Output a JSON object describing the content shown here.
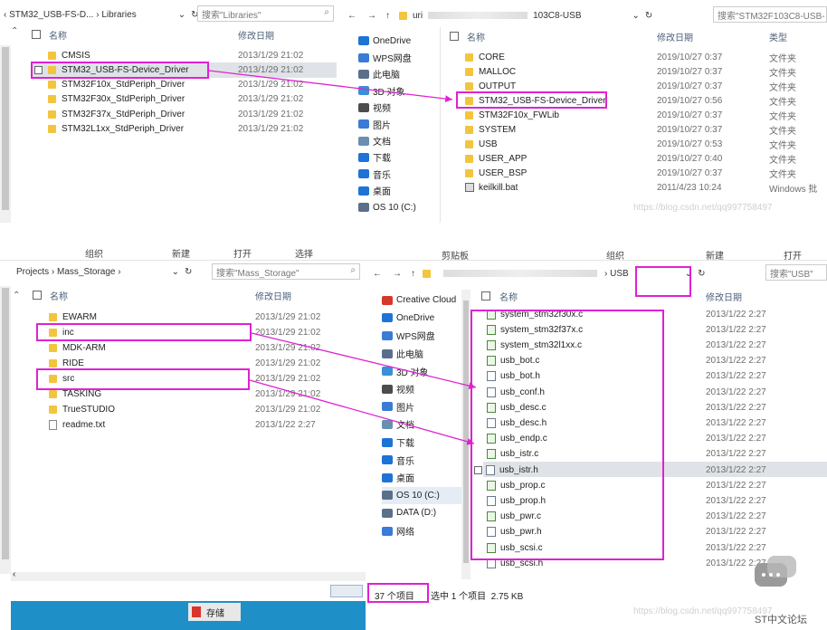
{
  "topLeft": {
    "address": "STM32_USB-FS-D...",
    "address2": "Libraries",
    "search": "搜索\"Libraries\"",
    "col_name": "名称",
    "col_date": "修改日期",
    "rows": [
      {
        "name": "CMSIS",
        "date": "2013/1/29 21:02"
      },
      {
        "name": "STM32_USB-FS-Device_Driver",
        "date": "2013/1/29 21:02"
      },
      {
        "name": "STM32F10x_StdPeriph_Driver",
        "date": "2013/1/29 21:02"
      },
      {
        "name": "STM32F30x_StdPeriph_Driver",
        "date": "2013/1/29 21:02"
      },
      {
        "name": "STM32F37x_StdPeriph_Driver",
        "date": "2013/1/29 21:02"
      },
      {
        "name": "STM32L1xx_StdPeriph_Driver",
        "date": "2013/1/29 21:02"
      }
    ]
  },
  "topRight": {
    "address": "uri",
    "address_tail": "103C8-USB",
    "search": "搜索\"STM32F103C8-USB-",
    "col_name": "名称",
    "col_date": "修改日期",
    "col_type": "类型",
    "nav": [
      "OneDrive",
      "WPS网盘",
      "此电脑",
      "3D 对象",
      "视频",
      "图片",
      "文档",
      "下载",
      "音乐",
      "桌面",
      "OS 10 (C:)"
    ],
    "rows": [
      {
        "name": "CORE",
        "date": "2019/10/27 0:37",
        "type": "文件夹"
      },
      {
        "name": "MALLOC",
        "date": "2019/10/27 0:37",
        "type": "文件夹"
      },
      {
        "name": "OUTPUT",
        "date": "2019/10/27 0:37",
        "type": "文件夹"
      },
      {
        "name": "STM32_USB-FS-Device_Driver",
        "date": "2019/10/27 0:56",
        "type": "文件夹"
      },
      {
        "name": "STM32F10x_FWLib",
        "date": "2019/10/27 0:37",
        "type": "文件夹"
      },
      {
        "name": "SYSTEM",
        "date": "2019/10/27 0:37",
        "type": "文件夹"
      },
      {
        "name": "USB",
        "date": "2019/10/27 0:53",
        "type": "文件夹"
      },
      {
        "name": "USER_APP",
        "date": "2019/10/27 0:40",
        "type": "文件夹"
      },
      {
        "name": "USER_BSP",
        "date": "2019/10/27 0:37",
        "type": "文件夹"
      },
      {
        "name": "keilkill.bat",
        "date": "2011/4/23 10:24",
        "type": "Windows 批"
      }
    ],
    "watermark": "https://blog.csdn.net/qq997758497"
  },
  "bottomLeft": {
    "ribbon": [
      "组织",
      "新建",
      "打开",
      "选择"
    ],
    "address": "Projects",
    "address2": "Mass_Storage",
    "search": "搜索\"Mass_Storage\"",
    "col_name": "名称",
    "col_date": "修改日期",
    "rows": [
      {
        "name": "EWARM",
        "date": "2013/1/29 21:02",
        "kind": "folder"
      },
      {
        "name": "inc",
        "date": "2013/1/29 21:02",
        "kind": "folder"
      },
      {
        "name": "MDK-ARM",
        "date": "2013/1/29 21:02",
        "kind": "folder"
      },
      {
        "name": "RIDE",
        "date": "2013/1/29 21:02",
        "kind": "folder"
      },
      {
        "name": "src",
        "date": "2013/1/29 21:02",
        "kind": "folder"
      },
      {
        "name": "TASKING",
        "date": "2013/1/29 21:02",
        "kind": "folder"
      },
      {
        "name": "TrueSTUDIO",
        "date": "2013/1/29 21:02",
        "kind": "folder"
      },
      {
        "name": "readme.txt",
        "date": "2013/1/22 2:27",
        "kind": "txt"
      }
    ],
    "taskbar": "存储"
  },
  "bottomRight": {
    "ribbon": [
      "剪贴板",
      "组织",
      "新建",
      "打开"
    ],
    "address": "USB",
    "search": "搜索\"USB\"",
    "col_name": "名称",
    "col_date": "修改日期",
    "nav": [
      "Creative Cloud",
      "OneDrive",
      "WPS网盘",
      "此电脑",
      "3D 对象",
      "视频",
      "图片",
      "文档",
      "下载",
      "音乐",
      "桌面",
      "OS 10 (C:)",
      "DATA (D:)",
      "网络"
    ],
    "rows": [
      {
        "name": "system_stm32f30x.c",
        "date": "2013/1/22 2:27",
        "green": true
      },
      {
        "name": "system_stm32f37x.c",
        "date": "2013/1/22 2:27",
        "green": true
      },
      {
        "name": "system_stm32l1xx.c",
        "date": "2013/1/22 2:27",
        "green": true
      },
      {
        "name": "usb_bot.c",
        "date": "2013/1/22 2:27",
        "green": true
      },
      {
        "name": "usb_bot.h",
        "date": "2013/1/22 2:27",
        "green": false
      },
      {
        "name": "usb_conf.h",
        "date": "2013/1/22 2:27",
        "green": false
      },
      {
        "name": "usb_desc.c",
        "date": "2013/1/22 2:27",
        "green": true
      },
      {
        "name": "usb_desc.h",
        "date": "2013/1/22 2:27",
        "green": false
      },
      {
        "name": "usb_endp.c",
        "date": "2013/1/22 2:27",
        "green": true
      },
      {
        "name": "usb_istr.c",
        "date": "2013/1/22 2:27",
        "green": true
      },
      {
        "name": "usb_istr.h",
        "date": "2013/1/22 2:27",
        "green": false
      },
      {
        "name": "usb_prop.c",
        "date": "2013/1/22 2:27",
        "green": true
      },
      {
        "name": "usb_prop.h",
        "date": "2013/1/22 2:27",
        "green": false
      },
      {
        "name": "usb_pwr.c",
        "date": "2013/1/22 2:27",
        "green": true
      },
      {
        "name": "usb_pwr.h",
        "date": "2013/1/22 2:27",
        "green": false
      },
      {
        "name": "usb_scsi.c",
        "date": "2013/1/22 2:27",
        "green": true
      },
      {
        "name": "usb_scsi.h",
        "date": "2013/1/22 2:27",
        "green": false
      }
    ],
    "status_count": "37 个项目",
    "status_sel": "选中 1 个项目  2.75 KB",
    "watermark": "https://blog.csdn.net/qq997758497",
    "logo_text": "ST中文论坛"
  },
  "colors": {
    "highlight": "#e021d2",
    "folder": "#f3c53e",
    "selection": "#dfe3e8"
  }
}
